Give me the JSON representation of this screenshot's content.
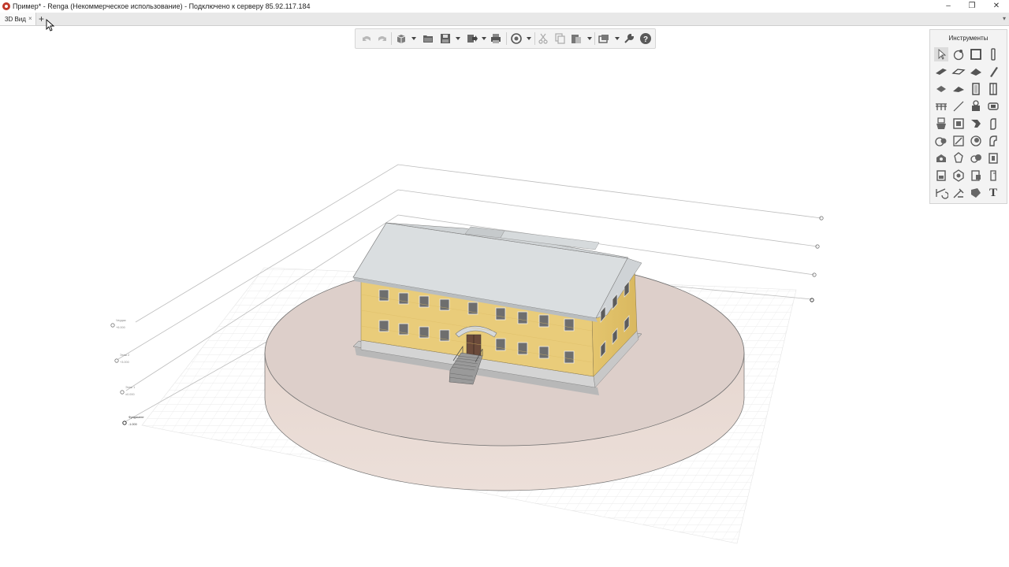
{
  "window": {
    "title": "Пример* - Renga (Некоммерческое использование) - Подключено к серверу 85.92.117.184",
    "minimize_glyph": "‒",
    "restore_glyph": "❐",
    "close_glyph": "✕"
  },
  "tabs": [
    {
      "label": "3D Вид",
      "close_glyph": "×",
      "active": true
    }
  ],
  "tab_add_glyph": "+",
  "tab_menu_glyph": "▾",
  "toolbar": {
    "buttons": [
      "undo-icon",
      "redo-icon",
      "view-cube-icon",
      "open-folder-icon",
      "save-icon",
      "export-icon",
      "print-icon",
      "orbit-icon",
      "cut-icon",
      "copy-icon",
      "paste-icon",
      "layers-icon",
      "settings-wrench-icon",
      "help-icon"
    ]
  },
  "tools_panel": {
    "title": "Инструменты",
    "text_tool_glyph": "T"
  },
  "scene": {
    "levels_left": [
      {
        "name": "Чердак",
        "elevation": "+6.000"
      },
      {
        "name": "Этаж 2",
        "elevation": "+3.000"
      },
      {
        "name": "Этаж 1",
        "elevation": "±0.000"
      },
      {
        "name": "Фундамент",
        "elevation": "-1.000"
      }
    ],
    "colors": {
      "platform_top": "#ddd0cb",
      "platform_side": "#e8dad3",
      "wall": "#e9cc7a",
      "roof": "#d9dddf",
      "grid": "#dcdcdc",
      "accent_stairs": "#8e8e8e"
    }
  }
}
